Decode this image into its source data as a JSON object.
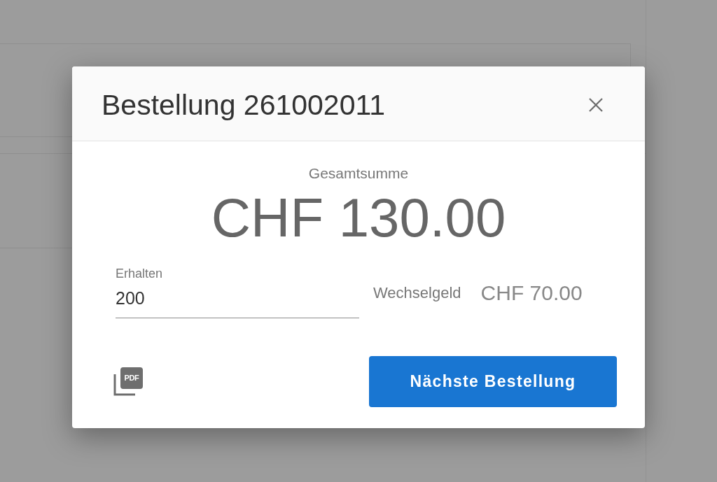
{
  "dialog": {
    "title": "Bestellung 261002011",
    "total": {
      "label": "Gesamtsumme",
      "amount": "CHF 130.00"
    },
    "received": {
      "label": "Erhalten",
      "value": "200"
    },
    "change": {
      "label": "Wechselgeld",
      "amount": "CHF 70.00"
    },
    "pdf_button": {
      "label": "PDF"
    },
    "primary_button": {
      "label": "Nächste Bestellung"
    }
  }
}
